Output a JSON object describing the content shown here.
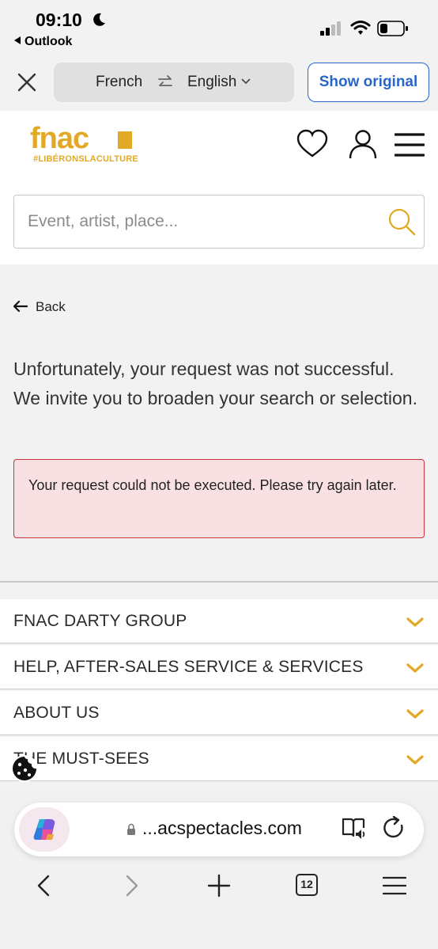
{
  "status_bar": {
    "time": "09:10",
    "back_app": "Outlook",
    "icons": [
      "moon-icon",
      "signal-icon",
      "wifi-icon",
      "battery-icon"
    ]
  },
  "translate_bar": {
    "from_language": "French",
    "to_language": "English",
    "show_original_label": "Show original",
    "accent_color": "#2a66c8"
  },
  "header": {
    "logo_text": "fnac",
    "logo_tagline": "#LIBÉRONSLACULTURE",
    "brand_color": "#e1a925",
    "search_placeholder": "Event, artist, place..."
  },
  "main": {
    "back_label": "Back",
    "message": "Unfortunately, your request was not successful. We invite you to broaden your search or selection.",
    "error_message": "Your request could not be executed. Please try again later.",
    "error_color": "#d0323c"
  },
  "footer": {
    "sections": [
      {
        "label": "FNAC DARTY GROUP"
      },
      {
        "label": "HELP, AFTER-SALES SERVICE & SERVICES"
      },
      {
        "label": "ABOUT US"
      },
      {
        "label": "THE MUST-SEES"
      }
    ]
  },
  "browser": {
    "url": "...acspectacles.com",
    "tab_count": "12"
  }
}
